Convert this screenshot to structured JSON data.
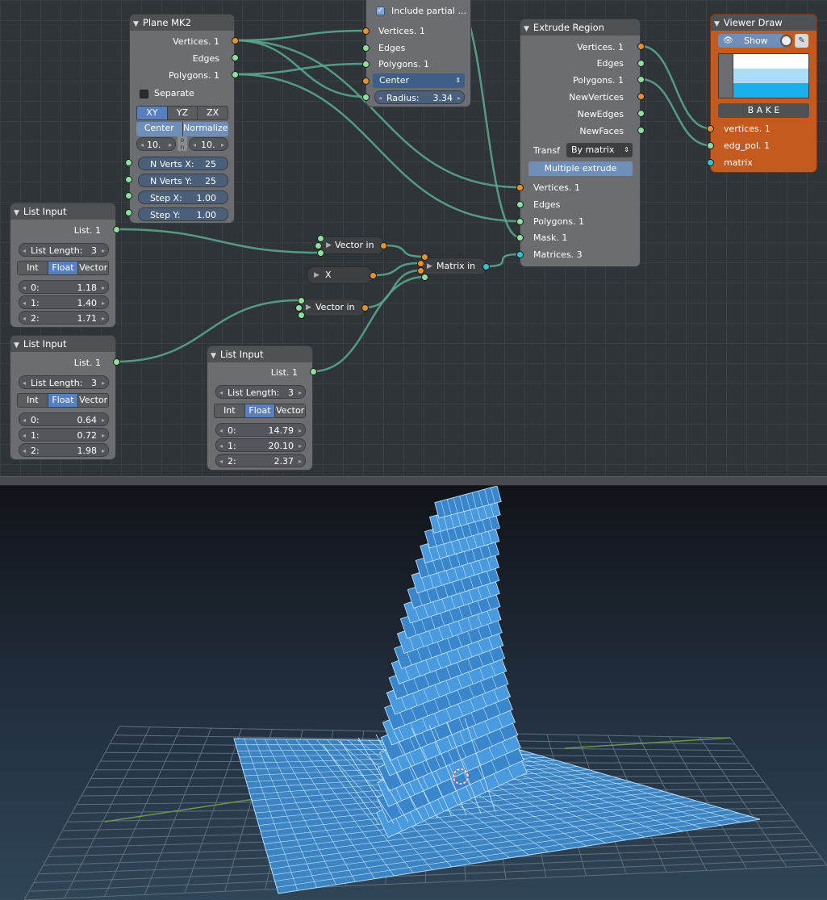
{
  "nodes": {
    "plane": {
      "title": "Plane MK2",
      "outputs": [
        "Vertices. 1",
        "Edges",
        "Polygons. 1"
      ],
      "separate_label": "Separate",
      "planes": [
        "XY",
        "YZ",
        "ZX"
      ],
      "center_label": "Center",
      "normalize_label": "Normalize",
      "size_x": "10.",
      "size_y": "10.",
      "link_icon": "link-toggle-icon",
      "n_verts_x_label": "N Verts X:",
      "n_verts_x": "25",
      "n_verts_y_label": "N Verts Y:",
      "n_verts_y": "25",
      "step_x_label": "Step X:",
      "step_x": "1.00",
      "step_y_label": "Step Y:",
      "step_y": "1.00"
    },
    "partial": {
      "include_label": "Include partial ...",
      "inputs": [
        "Vertices. 1",
        "Edges",
        "Polygons. 1"
      ],
      "mode": "Center",
      "radius_label": "Radius:",
      "radius": "3.34"
    },
    "extrude": {
      "title": "Extrude Region",
      "outputs": [
        "Vertices. 1",
        "Edges",
        "Polygons. 1",
        "NewVertices",
        "NewEdges",
        "NewFaces"
      ],
      "transf_label": "Transf",
      "transf_value": "By matrix",
      "multiple_label": "Multiple extrude",
      "inputs": [
        "Vertices. 1",
        "Edges",
        "Polygons. 1",
        "Mask. 1",
        "Matrices. 3"
      ]
    },
    "viewer": {
      "title": "Viewer Draw",
      "show_label": "Show",
      "bake_label": "B A K E",
      "colors": [
        "#ffffff",
        "#a8def8",
        "#1ab0ee"
      ],
      "inputs": [
        "vertices. 1",
        "edg_pol. 1",
        "matrix"
      ]
    },
    "list1": {
      "title": "List Input",
      "output": "List. 1",
      "length_label": "List Length:",
      "length": "3",
      "modes": [
        "Int",
        "Float",
        "Vector"
      ],
      "items": [
        {
          "k": "0:",
          "v": "1.18"
        },
        {
          "k": "1:",
          "v": "1.40"
        },
        {
          "k": "2:",
          "v": "1.71"
        }
      ]
    },
    "list2": {
      "title": "List Input",
      "output": "List. 1",
      "length_label": "List Length:",
      "length": "3",
      "modes": [
        "Int",
        "Float",
        "Vector"
      ],
      "items": [
        {
          "k": "0:",
          "v": "0.64"
        },
        {
          "k": "1:",
          "v": "0.72"
        },
        {
          "k": "2:",
          "v": "1.98"
        }
      ]
    },
    "list3": {
      "title": "List Input",
      "output": "List. 1",
      "length_label": "List Length:",
      "length": "3",
      "modes": [
        "Int",
        "Float",
        "Vector"
      ],
      "items": [
        {
          "k": "0:",
          "v": "14.79"
        },
        {
          "k": "1:",
          "v": "20.10"
        },
        {
          "k": "2:",
          "v": "2.37"
        }
      ]
    },
    "vector_in_1": {
      "title": "Vector in"
    },
    "x_node": {
      "title": "X"
    },
    "matrix_in": {
      "title": "Matrix in"
    },
    "vector_in_2": {
      "title": "Vector in"
    }
  },
  "colors": {
    "wire": "#5aa58c",
    "socket_orange": "#e8902c",
    "socket_green": "#8fe0a0",
    "socket_cyan": "#2fc5d2",
    "viewer_body": "#c45a1e",
    "mesh": "#3f8fd6"
  }
}
